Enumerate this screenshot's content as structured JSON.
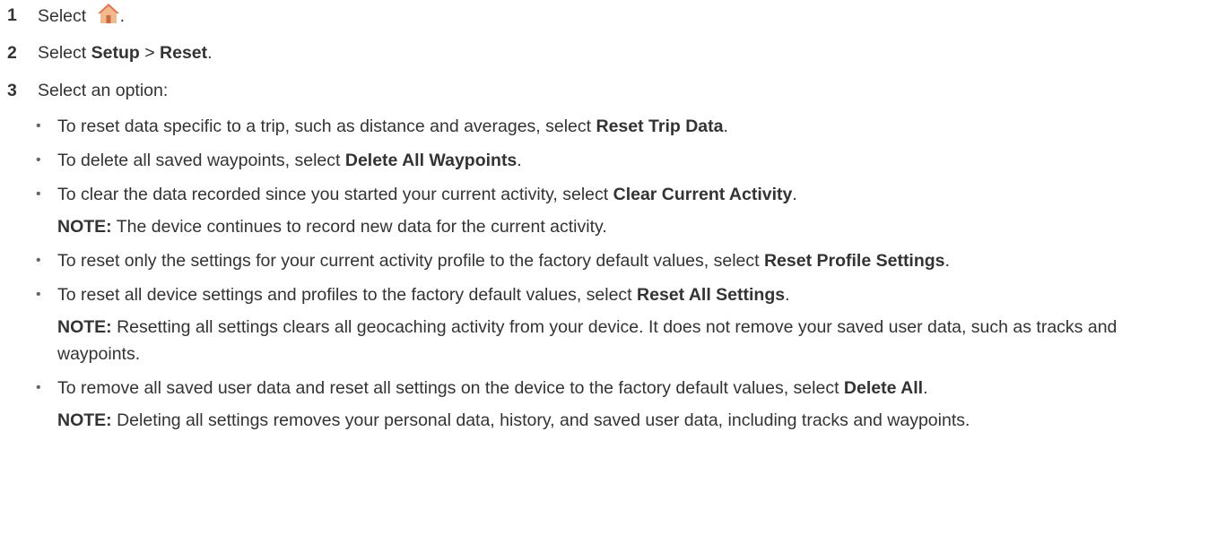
{
  "steps": [
    {
      "num": "1",
      "text_before": "Select ",
      "text_after": ".",
      "icon": "home-icon"
    },
    {
      "num": "2",
      "parts": [
        "Select ",
        "Setup",
        " > ",
        "Reset",
        "."
      ]
    },
    {
      "num": "3",
      "text": "Select an option:"
    }
  ],
  "options": [
    {
      "text": "To reset data specific to a trip, such as distance and averages, select ",
      "bold": "Reset Trip Data",
      "end": "."
    },
    {
      "text": "To delete all saved waypoints, select ",
      "bold": "Delete All Waypoints",
      "end": "."
    },
    {
      "text": "To clear the data recorded since you started your current activity, select ",
      "bold": "Clear Current Activity",
      "end": ".",
      "note_label": "NOTE:",
      "note_text": " The device continues to record new data for the current activity."
    },
    {
      "text": "To reset only the settings for your current activity profile to the factory default values, select ",
      "bold": "Reset Profile Settings",
      "end": "."
    },
    {
      "text": "To reset all device settings and profiles to the factory default values, select ",
      "bold": "Reset All Settings",
      "end": ".",
      "note_label": "NOTE:",
      "note_text": " Resetting all settings clears all geocaching activity from your device. It does not remove your saved user data, such as tracks and waypoints."
    },
    {
      "text": "To remove all saved user data and reset all settings on the device to the factory default values, select ",
      "bold": "Delete All",
      "end": ".",
      "note_label": "NOTE:",
      "note_text": " Deleting all settings removes your personal data, history, and saved user data, including tracks and waypoints."
    }
  ],
  "colors": {
    "text": "#333333",
    "house_roof": "#e8734a",
    "house_body": "#f2b98f",
    "house_door": "#c96a3b"
  }
}
